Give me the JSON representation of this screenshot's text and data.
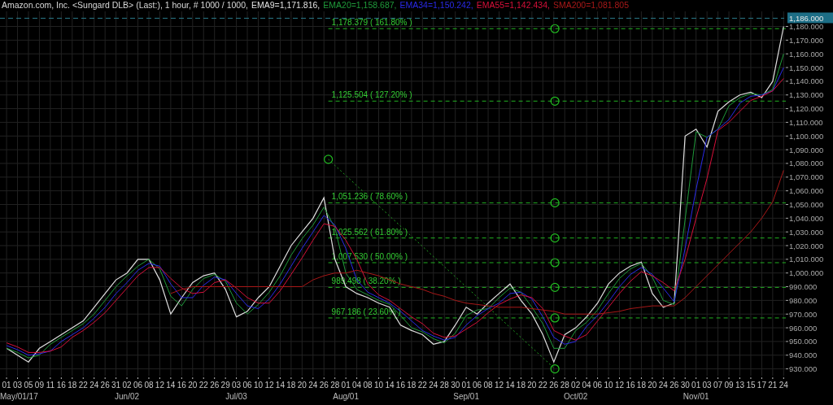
{
  "header": {
    "title": "Amazon.com, Inc.  <Sungard DLB> (Last:), 1 hour, # 1000 / 1000,",
    "indicator_values": [
      "=1,171.816,",
      "=1,158.687,",
      "=1,150.242,",
      "=1,142.434,",
      "=1,081.805"
    ]
  },
  "chart": {
    "month_labels": [
      "May/01/17",
      "Jun/02",
      "Jul/03",
      "Aug/01",
      "Sep/01",
      "Oct/02",
      "Nov/01"
    ],
    "chart_data": {
      "type": "line",
      "grid": true,
      "categories": [
        "01",
        "03",
        "05",
        "09",
        "11",
        "16",
        "18",
        "22",
        "24",
        "26",
        "31",
        "02",
        "06",
        "08",
        "12",
        "14",
        "16",
        "20",
        "22",
        "26",
        "29",
        "03",
        "06",
        "10",
        "12",
        "14",
        "18",
        "20",
        "24",
        "26",
        "28",
        "01",
        "04",
        "08",
        "10",
        "14",
        "16",
        "18",
        "22",
        "24",
        "28",
        "30",
        "01",
        "06",
        "08",
        "12",
        "14",
        "18",
        "20",
        "22",
        "26",
        "28",
        "02",
        "04",
        "06",
        "10",
        "12",
        "16",
        "18",
        "20",
        "24",
        "26",
        "30",
        "01",
        "03",
        "07",
        "09",
        "13",
        "15",
        "17",
        "21",
        "24"
      ],
      "ylim": [
        925,
        1191
      ],
      "yticks": [
        {
          "value": 1180,
          "label": "1,180.000"
        },
        {
          "value": 1170,
          "label": "1,170.000"
        },
        {
          "value": 1160,
          "label": "1,160.000"
        },
        {
          "value": 1150,
          "label": "1,150.000"
        },
        {
          "value": 1140,
          "label": "1,140.000"
        },
        {
          "value": 1130,
          "label": "1,130.000"
        },
        {
          "value": 1120,
          "label": "1,120.000"
        },
        {
          "value": 1110,
          "label": "1,110.000"
        },
        {
          "value": 1100,
          "label": "1,100.000"
        },
        {
          "value": 1090,
          "label": "1,090.000"
        },
        {
          "value": 1080,
          "label": "1,080.000"
        },
        {
          "value": 1070,
          "label": "1,070.000"
        },
        {
          "value": 1060,
          "label": "1,060.000"
        },
        {
          "value": 1050,
          "label": "1,050.000"
        },
        {
          "value": 1040,
          "label": "1,040.000"
        },
        {
          "value": 1030,
          "label": "1,030.000"
        },
        {
          "value": 1020,
          "label": "1,020.000"
        },
        {
          "value": 1010,
          "label": "1,010.000"
        },
        {
          "value": 1000,
          "label": "1,000.000"
        },
        {
          "value": 990,
          "label": "990.000"
        },
        {
          "value": 980,
          "label": "980.000"
        },
        {
          "value": 970,
          "label": "970.000"
        },
        {
          "value": 960,
          "label": "960.000"
        },
        {
          "value": 950,
          "label": "950.000"
        },
        {
          "value": 940,
          "label": "940.000"
        },
        {
          "value": 930,
          "label": "930.000"
        }
      ],
      "series": [
        {
          "name": "EMA9",
          "color": "#e0e0e0",
          "values": [
            945,
            940,
            935,
            945,
            950,
            955,
            960,
            965,
            975,
            985,
            995,
            1000,
            1010,
            1010,
            995,
            970,
            982,
            993,
            998,
            1000,
            988,
            968,
            972,
            982,
            990,
            1005,
            1020,
            1030,
            1040,
            1055,
            1010,
            990,
            985,
            982,
            978,
            975,
            962,
            958,
            955,
            948,
            950,
            962,
            975,
            970,
            978,
            985,
            992,
            980,
            970,
            955,
            935,
            955,
            960,
            968,
            978,
            992,
            1000,
            1005,
            1008,
            985,
            975,
            978,
            1100,
            1105,
            1092,
            1118,
            1125,
            1130,
            1132,
            1128,
            1140,
            1180
          ]
        },
        {
          "name": "EMA20",
          "color": "#1f9a3a",
          "values": [
            945,
            942,
            938,
            940,
            948,
            953,
            958,
            963,
            970,
            980,
            990,
            998,
            1005,
            1010,
            1003,
            983,
            976,
            988,
            996,
            999,
            994,
            978,
            970,
            977,
            986,
            998,
            1013,
            1025,
            1035,
            1048,
            1033,
            1000,
            988,
            984,
            980,
            977,
            969,
            960,
            957,
            952,
            949,
            956,
            969,
            973,
            974,
            982,
            989,
            986,
            975,
            963,
            945,
            945,
            958,
            964,
            973,
            985,
            996,
            1003,
            1007,
            997,
            980,
            977,
            1039,
            1103,
            1099,
            1105,
            1122,
            1128,
            1131,
            1130,
            1134,
            1160
          ]
        },
        {
          "name": "EMA34",
          "color": "#2a2ae8",
          "values": [
            947,
            944,
            940,
            941,
            943,
            950,
            955,
            960,
            967,
            975,
            985,
            993,
            1002,
            1007,
            1005,
            992,
            982,
            982,
            991,
            997,
            995,
            985,
            976,
            974,
            981,
            992,
            1005,
            1018,
            1030,
            1042,
            1035,
            1018,
            995,
            986,
            982,
            978,
            972,
            965,
            958,
            954,
            951,
            953,
            962,
            969,
            974,
            978,
            985,
            986,
            981,
            968,
            953,
            948,
            950,
            961,
            969,
            979,
            990,
            999,
            1004,
            999,
            989,
            979,
            1018,
            1061,
            1099,
            1105,
            1112,
            1124,
            1129,
            1130,
            1133,
            1150
          ]
        },
        {
          "name": "EMA55",
          "color": "#d8103a",
          "values": [
            949,
            946,
            942,
            942,
            943,
            946,
            953,
            958,
            964,
            971,
            980,
            989,
            998,
            1004,
            1004,
            996,
            989,
            985,
            986,
            993,
            995,
            989,
            982,
            978,
            978,
            987,
            999,
            1011,
            1024,
            1036,
            1034,
            1024,
            1010,
            992,
            984,
            980,
            974,
            968,
            963,
            956,
            953,
            954,
            959,
            964,
            971,
            977,
            981,
            984,
            982,
            974,
            958,
            954,
            951,
            955,
            965,
            975,
            985,
            994,
            1001,
            998,
            993,
            987,
            1010,
            1040,
            1069,
            1104,
            1110,
            1118,
            1126,
            1129,
            1133,
            1142
          ]
        },
        {
          "name": "SMA200",
          "color": "#a81818",
          "values": [
            null,
            null,
            null,
            null,
            null,
            null,
            null,
            null,
            null,
            null,
            null,
            null,
            null,
            null,
            null,
            985,
            988,
            990,
            990,
            990,
            990,
            990,
            990,
            990,
            990,
            990,
            990,
            990,
            995,
            998,
            1000,
            1000,
            1002,
            1000,
            998,
            995,
            992,
            990,
            988,
            985,
            983,
            980,
            978,
            977,
            976,
            975,
            975,
            975,
            974,
            973,
            972,
            970,
            970,
            970,
            970,
            971,
            972,
            974,
            975,
            976,
            976,
            976,
            982,
            990,
            998,
            1006,
            1014,
            1022,
            1030,
            1040,
            1052,
            1075
          ]
        }
      ],
      "ref_lines": [
        {
          "axis": "y",
          "value": 1178.379,
          "label": "1,178.379 ( 161.80% )"
        },
        {
          "axis": "y",
          "value": 1125.504,
          "label": "1,125.504 ( 127.20% )"
        },
        {
          "axis": "y",
          "value": 1051.236,
          "label": "1,051.236 ( 78.60% )"
        },
        {
          "axis": "y",
          "value": 1025.562,
          "label": "1,025.562 ( 61.80% )"
        },
        {
          "axis": "y",
          "value": 1007.53,
          "label": "1,007.530 ( 50.00% )"
        },
        {
          "axis": "y",
          "value": 989.498,
          "label": "989.498 ( 38.20% )"
        },
        {
          "axis": "y",
          "value": 967.186,
          "label": "967.186 ( 23.60% )"
        },
        {
          "axis": "y",
          "value": 1186,
          "label": "1,186.000"
        }
      ]
    }
  }
}
